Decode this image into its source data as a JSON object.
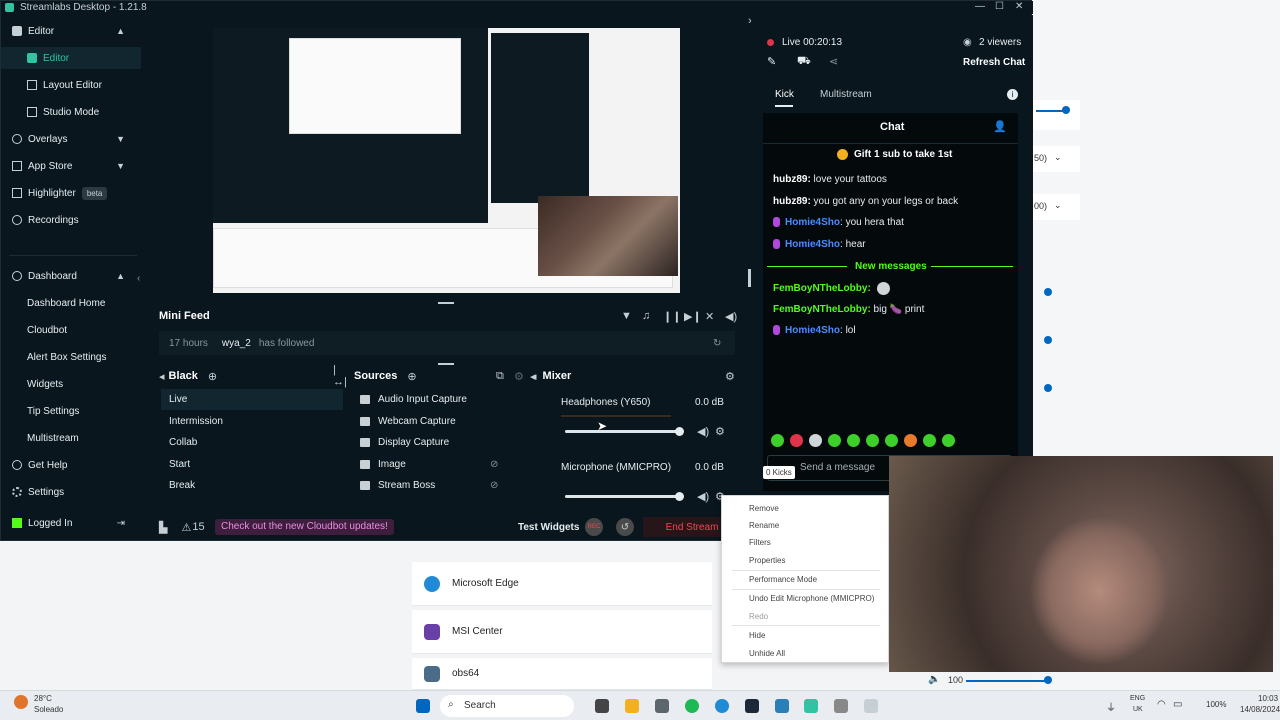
{
  "window": {
    "title": "Streamlabs Desktop - 1.21.8"
  },
  "sidebar": {
    "editor_group": "Editor",
    "items": [
      {
        "label": "Editor"
      },
      {
        "label": "Layout Editor"
      },
      {
        "label": "Studio Mode"
      }
    ],
    "overlays": "Overlays",
    "app_store": "App Store",
    "highlighter": "Highlighter",
    "highlighter_badge": "beta",
    "recordings": "Recordings",
    "dashboard_group": "Dashboard",
    "dashboard_items": [
      {
        "label": "Dashboard Home"
      },
      {
        "label": "Cloudbot"
      },
      {
        "label": "Alert Box Settings"
      },
      {
        "label": "Widgets"
      },
      {
        "label": "Tip Settings"
      },
      {
        "label": "Multistream"
      }
    ],
    "get_help": "Get Help",
    "settings": "Settings",
    "logged_in": "Logged In"
  },
  "mini_feed": {
    "title": "Mini Feed",
    "event": {
      "time": "17 hours",
      "user": "wya_2",
      "action": "has followed"
    }
  },
  "scenes": {
    "title": "Black",
    "items": [
      "Live",
      "Intermission",
      "Collab",
      "Start",
      "Break"
    ]
  },
  "sources": {
    "title": "Sources",
    "items": [
      "Audio Input Capture",
      "Webcam Capture",
      "Display Capture",
      "Image",
      "Stream Boss"
    ]
  },
  "mixer": {
    "title": "Mixer",
    "tracks": [
      {
        "name": "Headphones (Y650)",
        "level": "0.0 dB"
      },
      {
        "name": "Microphone (MMICPRO)",
        "level": "0.0 dB"
      }
    ]
  },
  "footer": {
    "alert_count": "15",
    "banner": "Check out the new Cloudbot updates!",
    "test_widgets": "Test Widgets",
    "rec": "REC",
    "end_stream": "End Stream"
  },
  "live": {
    "status": "Live 00:20:13",
    "viewers": "2 viewers",
    "refresh": "Refresh Chat",
    "tabs": [
      "Kick",
      "Multistream"
    ]
  },
  "chat": {
    "title": "Chat",
    "pinned": "Gift 1 sub to take 1st",
    "messages": [
      {
        "user": "hubz89:",
        "text": " love your tattoos"
      },
      {
        "user": "hubz89:",
        "text": " you got any on your legs or back"
      },
      {
        "user": "Homie4Sho",
        "text": ": you hera that"
      },
      {
        "user": "Homie4Sho",
        "text": ": hear"
      }
    ],
    "new_messages": "New messages",
    "new": [
      {
        "user": "FemBoyNTheLobby:",
        "text": ""
      },
      {
        "user": "FemBoyNTheLobby:",
        "text": " big 🍆 print"
      },
      {
        "user": "Homie4Sho",
        "text": ": lol"
      }
    ],
    "input_placeholder": "Send a message",
    "kicks": "0 Kicks"
  },
  "context_menu": {
    "items": [
      "Remove",
      "Rename",
      "Filters",
      "Properties",
      "Performance Mode",
      "Undo Edit Microphone (MMICPRO)",
      "Redo",
      "Hide",
      "Unhide All"
    ]
  },
  "background_apps": [
    "Microsoft Edge",
    "MSI Center",
    "obs64"
  ],
  "background_values": [
    "50)",
    "00)"
  ],
  "volume": {
    "value": "100"
  },
  "taskbar": {
    "weather_temp": "28°C",
    "weather_desc": "Soleado",
    "search": "Search",
    "lang1": "ENG",
    "lang2": "UK",
    "battery": "100%",
    "time": "10:03",
    "date": "14/08/2024"
  },
  "colors": {
    "accent": "#31c3a2",
    "kick_green": "#53fc18",
    "end_stream": "#f0474f",
    "live_red": "#e0344a"
  }
}
